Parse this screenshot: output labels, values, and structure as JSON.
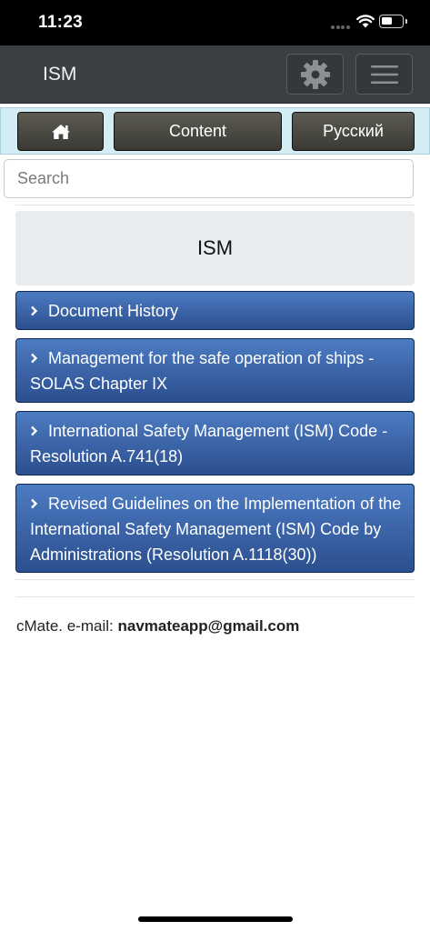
{
  "status_bar": {
    "time": "11:23"
  },
  "navbar": {
    "brand": "ISM",
    "settings_icon": "gear-icon",
    "menu_icon": "hamburger-icon"
  },
  "toolbar": {
    "home_icon": "home-icon",
    "content_label": "Content",
    "language_label": "Русский"
  },
  "search": {
    "placeholder": "Search",
    "value": ""
  },
  "page": {
    "title": "ISM"
  },
  "documents": [
    {
      "label": "Document History"
    },
    {
      "label": "Management for the safe operation of ships - SOLAS Chapter IX"
    },
    {
      "label": "International Safety Management (ISM) Code - Resolution A.741(18)"
    },
    {
      "label": "Revised Guidelines on the Implementation of the International Safety Management (ISM) Code by Administrations (Resolution A.1118(30))"
    }
  ],
  "footer": {
    "prefix": "cMate. e-mail: ",
    "email": "navmateapp@gmail.com"
  },
  "colors": {
    "navbar_bg": "#3b3e42",
    "button_row_bg": "#d4ecf3",
    "item_blue": "#2b4f8f"
  }
}
